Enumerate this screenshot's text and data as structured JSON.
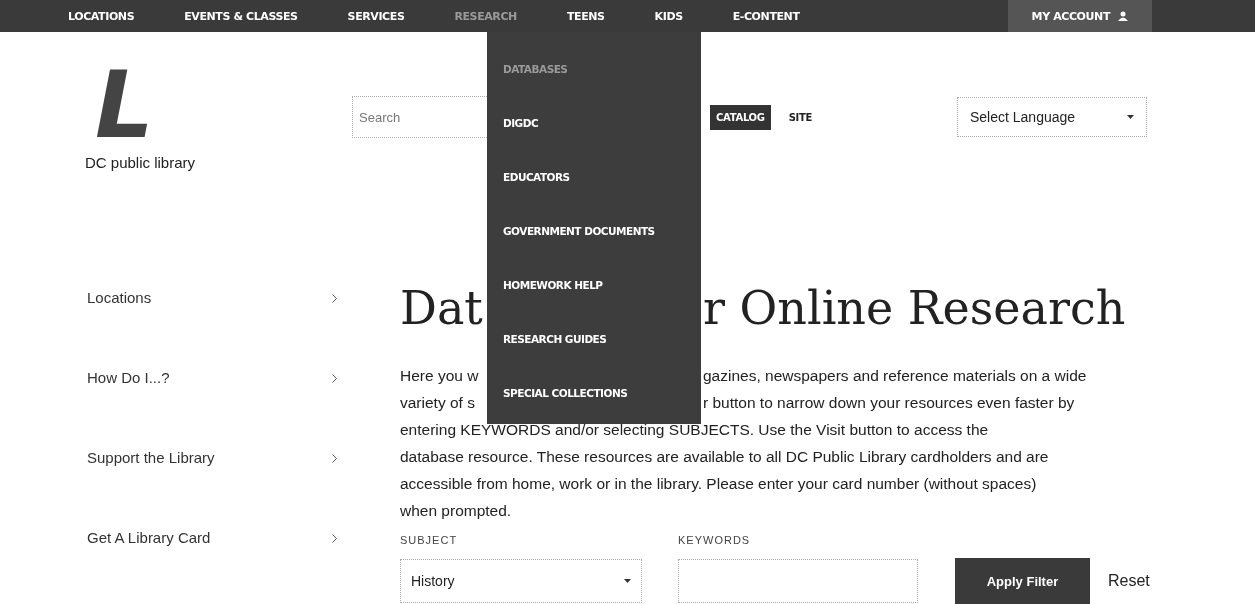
{
  "nav": {
    "items": [
      {
        "label": "LOCATIONS",
        "selected": false
      },
      {
        "label": "EVENTS & CLASSES",
        "selected": false
      },
      {
        "label": "SERVICES",
        "selected": false
      },
      {
        "label": "RESEARCH",
        "selected": true
      },
      {
        "label": "TEENS",
        "selected": false
      },
      {
        "label": "KIDS",
        "selected": false
      },
      {
        "label": "E-CONTENT",
        "selected": false
      }
    ],
    "account": {
      "label": "MY ACCOUNT"
    }
  },
  "research_menu": {
    "items": [
      {
        "label": "DATABASES",
        "selected": true
      },
      {
        "label": "DIGDC",
        "selected": false
      },
      {
        "label": "EDUCATORS",
        "selected": false
      },
      {
        "label": "GOVERNMENT DOCUMENTS",
        "selected": false
      },
      {
        "label": "HOMEWORK HELP",
        "selected": false
      },
      {
        "label": "RESEARCH GUIDES",
        "selected": false
      },
      {
        "label": "SPECIAL COLLECTIONS",
        "selected": false
      }
    ]
  },
  "header": {
    "logo": {
      "letter": "L",
      "name": "DC public library"
    },
    "search": {
      "placeholder": "Search"
    },
    "scope_tabs": [
      {
        "label": "CATALOG",
        "selected": true
      },
      {
        "label": "SITE",
        "selected": false
      }
    ],
    "language": {
      "value": "Select Language"
    }
  },
  "sidebar": {
    "items": [
      "Locations",
      "How Do I...?",
      "Support the Library",
      "Get A Library Card"
    ]
  },
  "heading": {
    "parts": [
      "Dat",
      "r Online Research"
    ]
  },
  "intro": {
    "lines": [
      [
        "Here you w",
        "gazines, newspapers and reference materials on a wide"
      ],
      [
        "variety of s",
        "r button to narrow down your resources even faster by"
      ],
      [
        "entering KEYWORDS and/or selecting SUBJECTS. Use the Visit button to access the"
      ],
      [
        "database resource. These resources are available to all DC Public Library cardholders and are"
      ],
      [
        "accessible from home, work or in the library. Please enter your card number (without spaces)"
      ],
      [
        "when prompted."
      ]
    ]
  },
  "filter": {
    "subject": {
      "label": "SUBJECT",
      "value": "History"
    },
    "keywords": {
      "label": "KEYWORDS"
    },
    "apply": "Apply Filter",
    "reset": "Reset"
  }
}
